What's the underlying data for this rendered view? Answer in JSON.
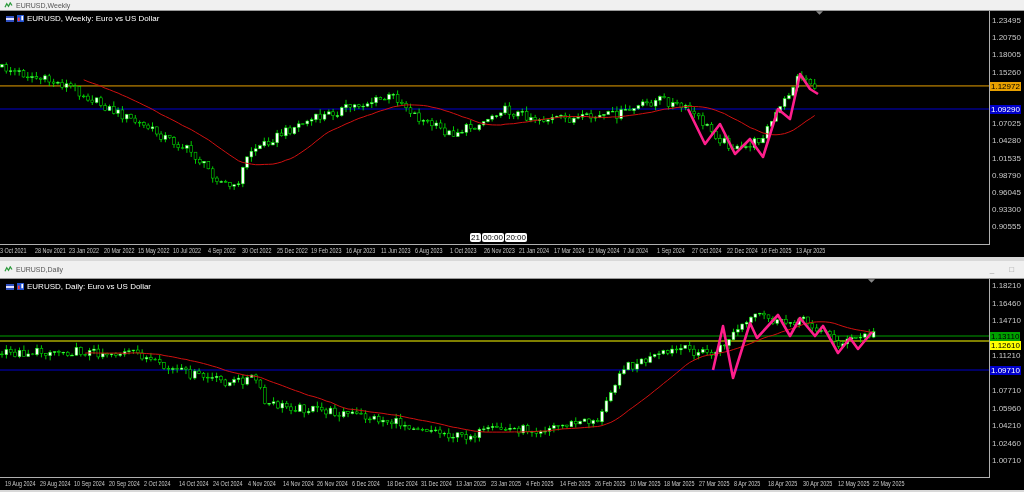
{
  "windows": [
    {
      "title": "EURUSD,Weekly",
      "chart_label": "EURUSD, Weekly:  Euro vs US Dollar",
      "price_ticks": [
        "1.23495",
        "1.20750",
        "1.18005",
        "1.15260",
        "1.07025",
        "1.04280",
        "1.01535",
        "0.98790",
        "0.96045",
        "0.93300",
        "0.90555"
      ],
      "price_tags": [
        {
          "text": "1.12972",
          "color": "#e8a000"
        },
        {
          "text": "1.09290",
          "color": "#0000cc"
        }
      ],
      "date_ticks": [
        "3 Oct 2021",
        "28 Nov 2021",
        "23 Jan 2022",
        "20 Mar 2022",
        "15 May 2022",
        "10 Jul 2022",
        "4 Sep 2022",
        "30 Oct 2022",
        "25 Dec 2022",
        "19 Feb 2023",
        "16 Apr 2023",
        "11 Jun 2023",
        "6 Aug 2023",
        "1 Oct 2023",
        "26 Nov 2023",
        "21 Jan 2024",
        "17 Mar 2024",
        "12 May 2024",
        "7 Jul 2024",
        "1 Sep 2024",
        "27 Oct 2024",
        "22 Dec 2024",
        "16 Feb 2025",
        "13 Apr 2025"
      ],
      "time_labels": [
        "21",
        "00:00",
        "20:00"
      ]
    },
    {
      "title": "EURUSD,Daily",
      "window_controls": [
        "_",
        "□"
      ],
      "chart_label": "EURUSD, Daily:  Euro vs US Dollar",
      "price_ticks": [
        "1.18210",
        "1.16460",
        "1.14710",
        "1.11210",
        "1.07710",
        "1.05960",
        "1.04210",
        "1.02460",
        "1.00710"
      ],
      "price_tags": [
        {
          "text": "1.13110",
          "color": "#00a000"
        },
        {
          "text": "1.12610",
          "color": "#ffff00"
        },
        {
          "text": "1.09710",
          "color": "#0000cc"
        }
      ],
      "date_ticks": [
        "19 Aug 2024",
        "29 Aug 2024",
        "10 Sep 2024",
        "20 Sep 2024",
        "2 Oct 2024",
        "14 Oct 2024",
        "24 Oct 2024",
        "4 Nov 2024",
        "14 Nov 2024",
        "26 Nov 2024",
        "6 Dec 2024",
        "18 Dec 2024",
        "31 Dec 2024",
        "13 Jan 2025",
        "23 Jan 2025",
        "4 Feb 2025",
        "14 Feb 2025",
        "26 Feb 2025",
        "10 Mar 2025",
        "18 Mar 2025",
        "27 Mar 2025",
        "8 Apr 2025",
        "18 Apr 2025",
        "30 Apr 2025",
        "12 May 2025",
        "22 May 2025"
      ]
    }
  ]
}
